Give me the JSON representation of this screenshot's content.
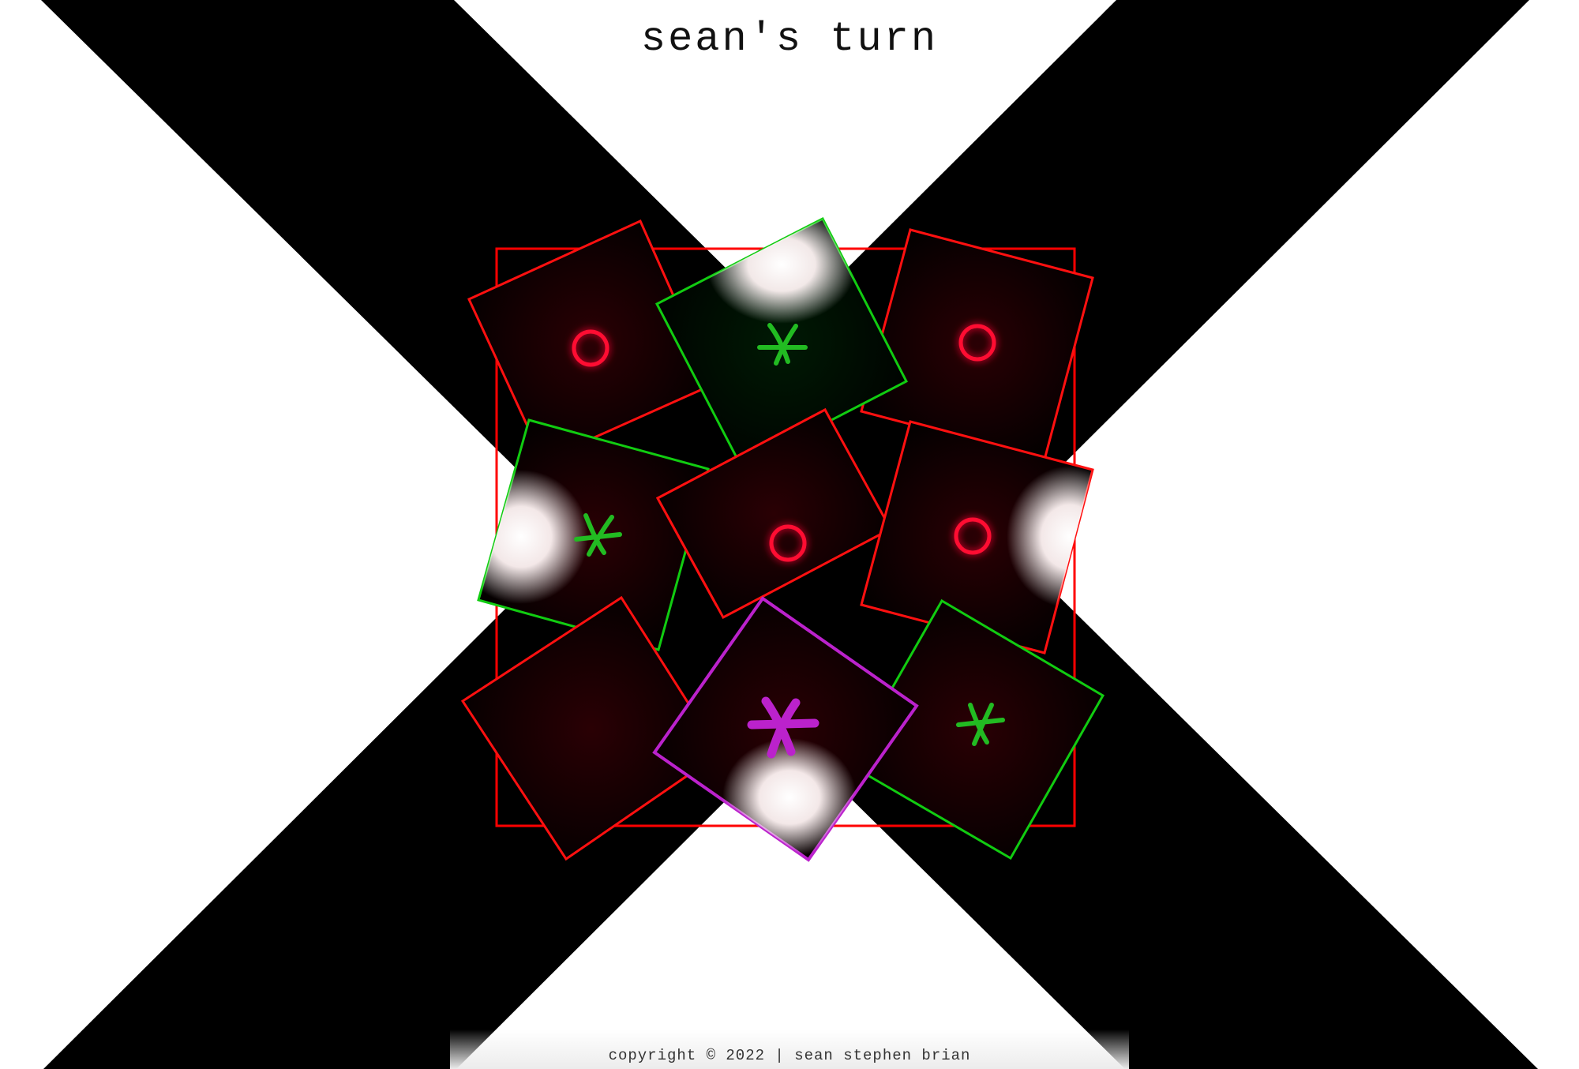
{
  "header": {
    "turn_text": "sean's turn"
  },
  "footer": {
    "copyright": "copyright © 2022 | sean stephen brian"
  },
  "colors": {
    "background": "#ffffff",
    "x_band": "#000000",
    "board_border": "#ff0000",
    "o_mark": "#ff1133",
    "x_mark": "#22bb22",
    "selected_mark": "#bb22cc",
    "cell_fill": "#000000"
  },
  "board": {
    "cells": [
      {
        "id": "top-left",
        "mark": "O",
        "border": "red",
        "selected": false,
        "icon": "o-icon"
      },
      {
        "id": "top-middle",
        "mark": "X",
        "border": "green",
        "selected": false,
        "icon": "x-icon"
      },
      {
        "id": "top-right",
        "mark": "O",
        "border": "red",
        "selected": false,
        "icon": "o-icon"
      },
      {
        "id": "middle-left",
        "mark": "X",
        "border": "green",
        "selected": false,
        "icon": "x-icon"
      },
      {
        "id": "center",
        "mark": "O",
        "border": "red",
        "selected": false,
        "icon": "o-icon"
      },
      {
        "id": "middle-right",
        "mark": "O",
        "border": "red",
        "selected": false,
        "icon": "o-icon"
      },
      {
        "id": "bottom-left",
        "mark": "",
        "border": "red",
        "selected": false,
        "icon": ""
      },
      {
        "id": "bottom-middle",
        "mark": "X",
        "border": "magenta",
        "selected": true,
        "icon": "x-icon"
      },
      {
        "id": "bottom-right",
        "mark": "X",
        "border": "green",
        "selected": false,
        "icon": "x-icon"
      }
    ]
  }
}
